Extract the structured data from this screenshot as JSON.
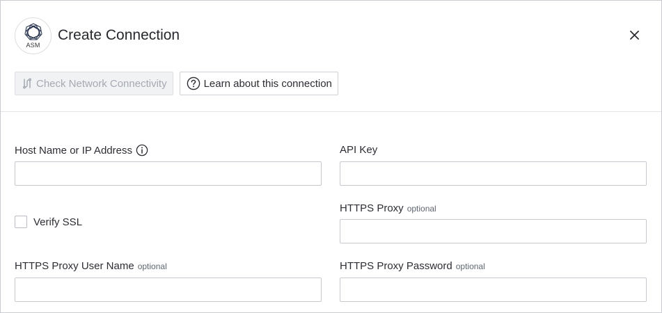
{
  "header": {
    "logo_text": "ASM",
    "title": "Create Connection"
  },
  "toolbar": {
    "check_network_label": "Check Network Connectivity",
    "learn_label": "Learn about this connection"
  },
  "form": {
    "host": {
      "label": "Host Name or IP Address",
      "value": ""
    },
    "api_key": {
      "label": "API Key",
      "value": ""
    },
    "verify_ssl": {
      "label": "Verify SSL",
      "checked": false
    },
    "https_proxy": {
      "label": "HTTPS Proxy",
      "optional": "optional",
      "value": ""
    },
    "proxy_user": {
      "label": "HTTPS Proxy User Name",
      "optional": "optional",
      "value": ""
    },
    "proxy_password": {
      "label": "HTTPS Proxy Password",
      "optional": "optional",
      "value": ""
    }
  }
}
